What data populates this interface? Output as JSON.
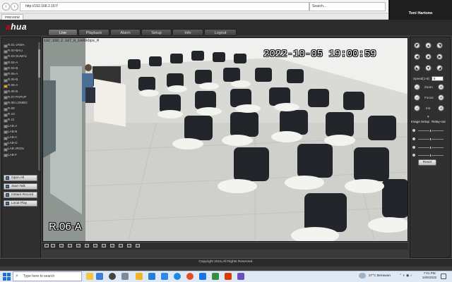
{
  "browser": {
    "url": "http://192.168.2.167/",
    "search_placeholder": "Search...",
    "tab_title": "PREVIEW"
  },
  "pip": {
    "name": "Toni Hartono",
    "footer_name": "Toni Hartono"
  },
  "app": {
    "brand_a": "a",
    "brand_b": "hua",
    "nav": [
      {
        "label": "Live"
      },
      {
        "label": "Playback"
      },
      {
        "label": "Alarm"
      },
      {
        "label": "Setup"
      },
      {
        "label": "Info"
      },
      {
        "label": "Logout"
      }
    ]
  },
  "channels": [
    "R.01-JAWA",
    "R.02-BALI",
    "R.03-SUMA1",
    "R.04-A",
    "R.04-B",
    "R.05-A",
    "R.05-B",
    "R.06-A",
    "R.06-B",
    "R.07-PAPUP",
    "R.08-LOMBO",
    "R.09",
    "R.10",
    "R.11",
    "LAB-A",
    "LAB-B",
    "LAB-C",
    "LAB-D",
    "LAB-JRGN",
    "LAB-F"
  ],
  "side_buttons": {
    "open_all": "Open All",
    "start_talk": "Start Talk",
    "instant_record": "Instant Record",
    "local_play": "Local Play"
  },
  "video": {
    "info_line": "192.168.2.167_0_1095kbps_M",
    "timestamp": "2022-10-05 19:00:59",
    "channel_label": "R.06-A"
  },
  "ptz": {
    "speed_label": "Speed(1-8)",
    "speed_value": "5",
    "zoom_label": "Zoom",
    "focus_label": "Focus",
    "iris_label": "Iris"
  },
  "image_setup": {
    "tab_image": "Image Setup",
    "tab_relay": "Relay-out",
    "reset_label": "Reset"
  },
  "footer": {
    "copyright": "Copyright 2015,All Rights Reserved."
  },
  "taskbar": {
    "search_placeholder": "Type here to search",
    "weather": "27°C  Berawan",
    "time": "7:01 PM",
    "date": "10/5/2022"
  }
}
